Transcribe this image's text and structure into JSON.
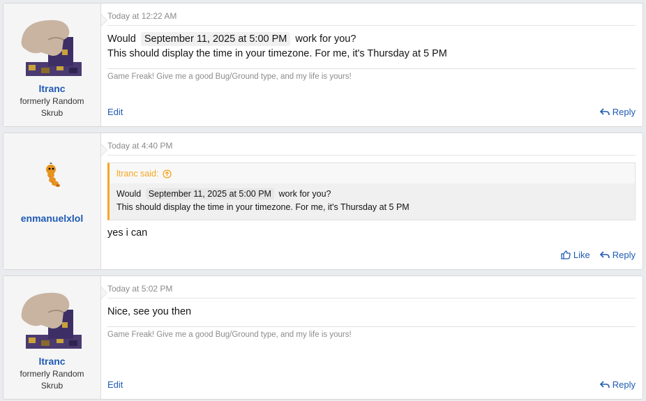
{
  "posts": [
    {
      "username": "ltranc",
      "user_title": "formerly Random Skrub",
      "timestamp": "Today at 12:22 AM",
      "body_pre": "Would",
      "body_time": "September 11, 2025 at 5:00 PM",
      "body_post": "work for you?",
      "body_line2": "This should display the time in your timezone. For me, it's Thursday at 5 PM",
      "signature": "Game Freak! Give me a good Bug/Ground type, and my life is yours!",
      "edit_label": "Edit",
      "reply_label": "Reply"
    },
    {
      "username": "enmanuelxlol",
      "timestamp": "Today at 4:40 PM",
      "quote_author": "ltranc said:",
      "quote_pre": "Would",
      "quote_time": "September 11, 2025 at 5:00 PM",
      "quote_post": "work for you?",
      "quote_line2": "This should display the time in your timezone. For me, it's Thursday at 5 PM",
      "body": "yes i can",
      "like_label": "Like",
      "reply_label": "Reply"
    },
    {
      "username": "ltranc",
      "user_title": "formerly Random Skrub",
      "timestamp": "Today at 5:02 PM",
      "body": "Nice, see you then",
      "signature": "Game Freak! Give me a good Bug/Ground type, and my life is yours!",
      "edit_label": "Edit",
      "reply_label": "Reply"
    }
  ],
  "icons": {
    "reply": "reply-icon",
    "like": "thumbs-up-icon",
    "quote_jump": "arrow-up-circle-icon"
  },
  "colors": {
    "link": "#1f5ab4",
    "quote_accent": "#f5a623"
  }
}
